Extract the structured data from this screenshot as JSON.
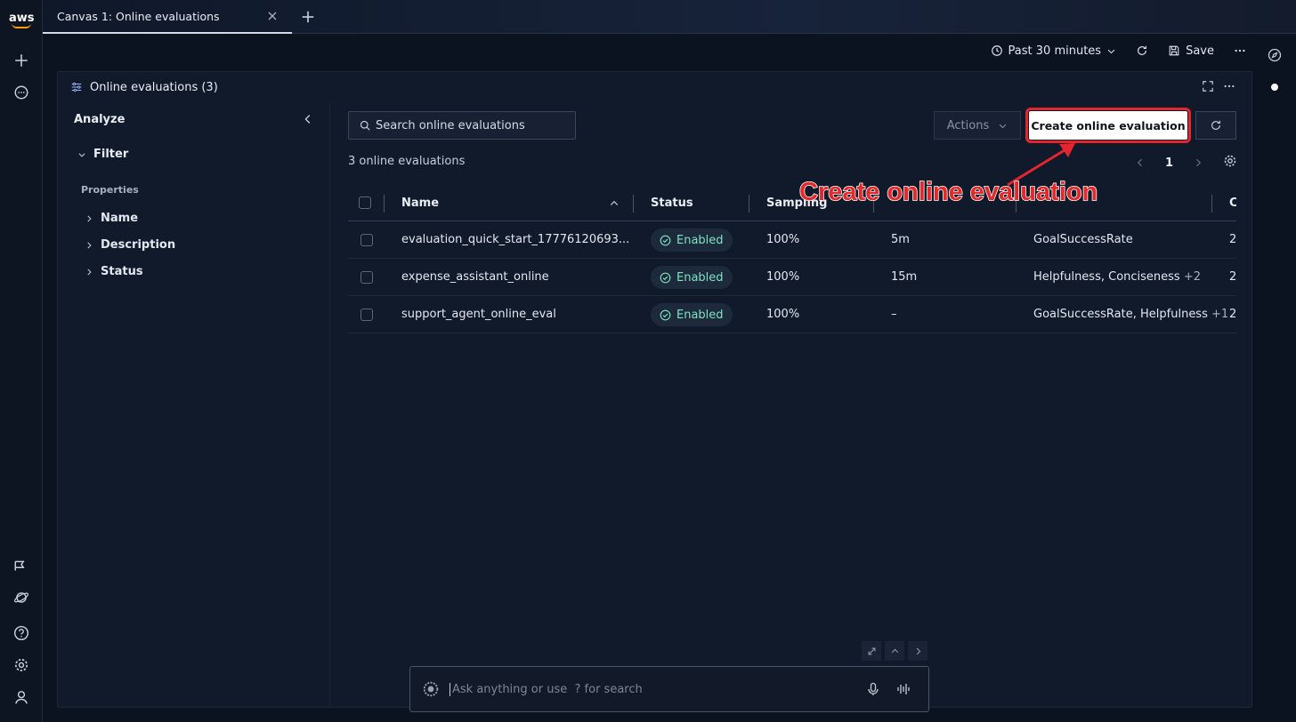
{
  "app": {
    "logo_text": "aws"
  },
  "tabs": [
    {
      "label": "Canvas 1: Online evaluations"
    }
  ],
  "toolbar": {
    "time_range": "Past 30 minutes",
    "save_label": "Save"
  },
  "panel": {
    "title": "Online evaluations (3)",
    "analyze": {
      "title": "Analyze",
      "filter_label": "Filter",
      "properties_label": "Properties",
      "properties": [
        "Name",
        "Description",
        "Status"
      ]
    },
    "search": {
      "placeholder": "Search online evaluations"
    },
    "actions_label": "Actions",
    "create_label": "Create online evaluation",
    "count_text": "3 online evaluations",
    "page": "1",
    "table": {
      "headers": [
        "Name",
        "Status",
        "Sampling",
        "",
        "",
        "C"
      ],
      "rows": [
        {
          "name": "evaluation_quick_start_17776120693...",
          "status": "Enabled",
          "sampling": "100%",
          "window": "5m",
          "evaluators": "GoalSuccessRate",
          "more": "",
          "last": "2"
        },
        {
          "name": "expense_assistant_online",
          "status": "Enabled",
          "sampling": "100%",
          "window": "15m",
          "evaluators": "Helpfulness, Conciseness",
          "more": "+2",
          "last": "2"
        },
        {
          "name": "support_agent_online_eval",
          "status": "Enabled",
          "sampling": "100%",
          "window": "–",
          "evaluators": "GoalSuccessRate, Helpfulness",
          "more": "+1",
          "last": "2"
        }
      ]
    }
  },
  "annotation": {
    "text": "Create online evaluation",
    "color": "#e32a2a"
  },
  "ask": {
    "placeholder": "Ask anything or use  ? for search"
  },
  "colors": {
    "accent_teal": "#7fe3c3",
    "highlight_red": "#e3262e"
  }
}
